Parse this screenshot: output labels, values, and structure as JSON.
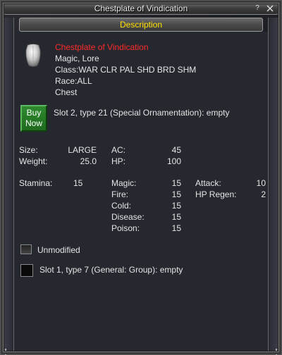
{
  "window": {
    "title": "Chestplate of Vindication",
    "help_label": "?"
  },
  "tab": {
    "label": "Description"
  },
  "item": {
    "name": "Chestplate of Vindication",
    "flags": "Magic, Lore",
    "classes": "Class:WAR CLR PAL SHD BRD SHM",
    "races": "Race:ALL",
    "slot": "Chest",
    "icon": "chestplate-icon"
  },
  "buy_button": {
    "line1": "Buy",
    "line2": "Now"
  },
  "ornament_slot": "Slot 2, type 21 (Special Ornamentation): empty",
  "stats": {
    "size_label": "Size:",
    "size_value": "LARGE",
    "weight_label": "Weight:",
    "weight_value": "25.0",
    "ac_label": "AC:",
    "ac_value": "45",
    "hp_label": "HP:",
    "hp_value": "100",
    "stamina_label": "Stamina:",
    "stamina_value": "15",
    "magic_label": "Magic:",
    "magic_value": "15",
    "fire_label": "Fire:",
    "fire_value": "15",
    "cold_label": "Cold:",
    "cold_value": "15",
    "disease_label": "Disease:",
    "disease_value": "15",
    "poison_label": "Poison:",
    "poison_value": "15",
    "attack_label": "Attack:",
    "attack_value": "10",
    "hpregen_label": "HP Regen:",
    "hpregen_value": "2"
  },
  "modifier": {
    "label": "Unmodified"
  },
  "general_slot": "Slot 1, type 7 (General: Group): empty",
  "colors": {
    "item_name": "#ff2a2a",
    "tab_label": "#ffe000",
    "buy_button": "#2f8a2f"
  }
}
